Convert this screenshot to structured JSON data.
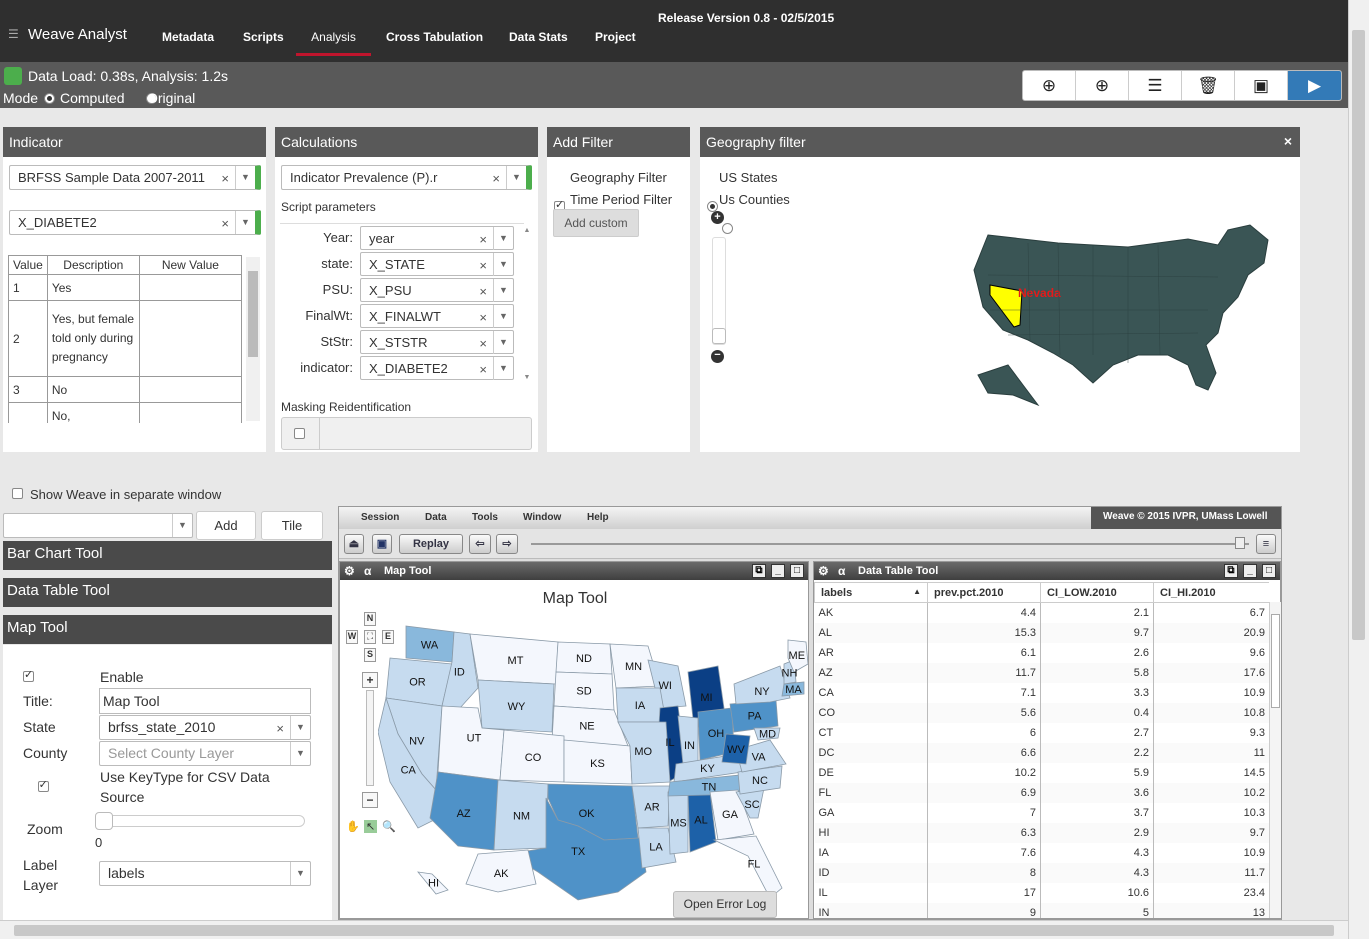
{
  "app": {
    "title": "Weave Analyst",
    "release": "Release Version 0.8 - 02/5/2015"
  },
  "nav": [
    "Metadata",
    "Scripts",
    "Analysis",
    "Cross Tabulation",
    "Data Stats",
    "Project"
  ],
  "status": {
    "text": "Data Load: 0.38s, Analysis: 1.2s",
    "mode_label": "Mode",
    "computed": "Computed",
    "original": "Original"
  },
  "toolbar_icons": [
    "download-icon",
    "upload-icon",
    "list-icon",
    "trash-icon",
    "save-icon",
    "run-icon"
  ],
  "indicator": {
    "title": "Indicator",
    "dataset": "BRFSS Sample Data 2007-2011",
    "column": "X_DIABETE2",
    "table_headers": [
      "Value",
      "Description",
      "New Value"
    ],
    "rows": [
      {
        "value": "1",
        "description": "Yes"
      },
      {
        "value": "2",
        "description": "Yes, but female told only during pregnancy"
      },
      {
        "value": "3",
        "description": "No"
      },
      {
        "value": "",
        "description": "No,"
      }
    ]
  },
  "calculations": {
    "title": "Calculations",
    "script": "Indicator Prevalence (P).r",
    "params_label": "Script parameters",
    "params": [
      {
        "label": "Year:",
        "value": "year"
      },
      {
        "label": "state:",
        "value": "X_STATE"
      },
      {
        "label": "PSU:",
        "value": "X_PSU"
      },
      {
        "label": "FinalWt:",
        "value": "X_FINALWT"
      },
      {
        "label": "StStr:",
        "value": "X_STSTR"
      },
      {
        "label": "indicator:",
        "value": "X_DIABETE2"
      }
    ],
    "masking_label": "Masking Reidentification"
  },
  "add_filter": {
    "title": "Add Filter",
    "geo": "Geography Filter",
    "time": "Time Period Filter",
    "custom": "Add custom"
  },
  "geo_filter": {
    "title": "Geography filter",
    "close": "×",
    "us_states": "US States",
    "us_counties": "Us Counties",
    "selected_state": "Nevada"
  },
  "left": {
    "show_weave": "Show Weave in separate window",
    "add": "Add",
    "tile": "Tile",
    "tools": [
      "Bar Chart Tool",
      "Data Table Tool",
      "Map Tool"
    ],
    "enable": "Enable",
    "title_label": "Title:",
    "title_value": "Map Tool",
    "state_label": "State",
    "state_value": "brfss_state_2010",
    "county_label": "County",
    "county_placeholder": "Select County Layer",
    "keytype": "Use KeyType for CSV Data Source",
    "zoom_label": "Zoom",
    "zoom_value": "0",
    "label_layer": "Label Layer",
    "label_layer_value": "labels"
  },
  "weave": {
    "menu": [
      "Session",
      "Data",
      "Tools",
      "Window",
      "Help"
    ],
    "copyright": "Weave © 2015 IVPR, UMass Lowell",
    "replay": "Replay",
    "map_title": "Map Tool",
    "map_chart_title": "Map Tool",
    "nav_letters": [
      "N",
      "W",
      "E",
      "S"
    ],
    "table_title": "Data Table Tool",
    "columns": [
      "labels",
      "prev.pct.2010",
      "CI_LOW.2010",
      "CI_HI.2010"
    ],
    "rows": [
      [
        "AK",
        "4.4",
        "2.1",
        "6.7"
      ],
      [
        "AL",
        "15.3",
        "9.7",
        "20.9"
      ],
      [
        "AR",
        "6.1",
        "2.6",
        "9.6"
      ],
      [
        "AZ",
        "11.7",
        "5.8",
        "17.6"
      ],
      [
        "CA",
        "7.1",
        "3.3",
        "10.9"
      ],
      [
        "CO",
        "5.6",
        "0.4",
        "10.8"
      ],
      [
        "CT",
        "6",
        "2.7",
        "9.3"
      ],
      [
        "DC",
        "6.6",
        "2.2",
        "11"
      ],
      [
        "DE",
        "10.2",
        "5.9",
        "14.5"
      ],
      [
        "FL",
        "6.9",
        "3.6",
        "10.2"
      ],
      [
        "GA",
        "7",
        "3.7",
        "10.3"
      ],
      [
        "HI",
        "6.3",
        "2.9",
        "9.7"
      ],
      [
        "IA",
        "7.6",
        "4.3",
        "10.9"
      ],
      [
        "ID",
        "8",
        "4.3",
        "11.7"
      ],
      [
        "IL",
        "17",
        "10.6",
        "23.4"
      ],
      [
        "IN",
        "9",
        "5",
        "13"
      ]
    ],
    "error_log": "Open Error Log"
  },
  "map_labels": [
    "WA",
    "OR",
    "ID",
    "MT",
    "ND",
    "SD",
    "WY",
    "NE",
    "NV",
    "UT",
    "CO",
    "KS",
    "CA",
    "AZ",
    "NM",
    "OK",
    "TX",
    "MN",
    "WI",
    "IA",
    "IL",
    "MO",
    "AR",
    "LA",
    "MS",
    "AL",
    "MI",
    "IN",
    "OH",
    "KY",
    "TN",
    "GA",
    "FL",
    "SC",
    "NC",
    "VA",
    "WV",
    "PA",
    "NY",
    "MD",
    "MA",
    "NH",
    "ME",
    "AK",
    "HI"
  ]
}
